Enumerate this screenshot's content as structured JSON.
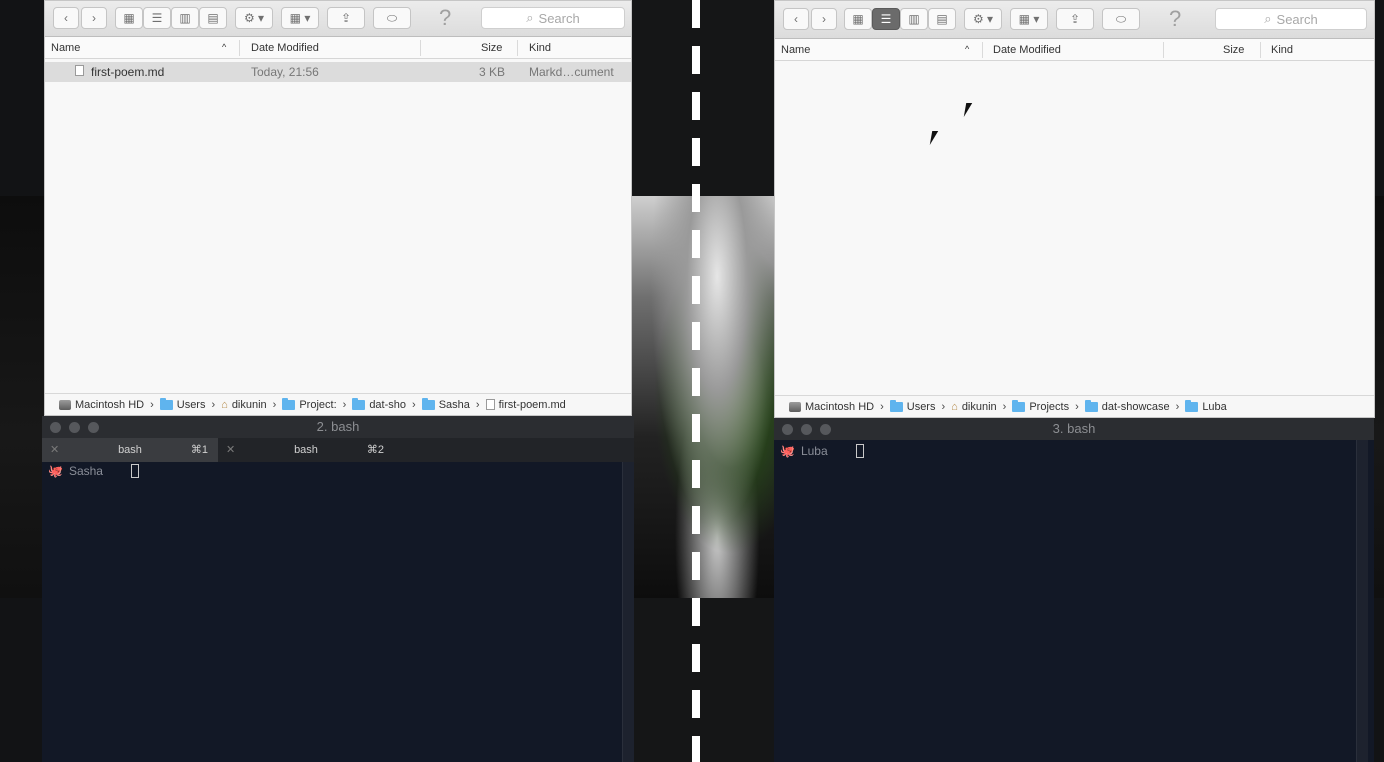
{
  "left_finder": {
    "nav_back_icon": "chevron-left-icon",
    "nav_forward_icon": "chevron-right-icon",
    "search_placeholder": "Search",
    "help_symbol": "?",
    "columns": {
      "name": "Name",
      "date": "Date Modified",
      "size": "Size",
      "kind": "Kind"
    },
    "files": [
      {
        "name": "first-poem.md",
        "date": "Today, 21:56",
        "size": "3 KB",
        "kind": "Markd…cument"
      }
    ],
    "path": [
      "Macintosh HD",
      "Users",
      "dikunin",
      "Project:",
      "dat-sho",
      "Sasha",
      "first-poem.md"
    ]
  },
  "right_finder": {
    "search_placeholder": "Search",
    "help_symbol": "?",
    "columns": {
      "name": "Name",
      "date": "Date Modified",
      "size": "Size",
      "kind": "Kind"
    },
    "path": [
      "Macintosh HD",
      "Users",
      "dikunin",
      "Projects",
      "dat-showcase",
      "Luba"
    ]
  },
  "left_terminal": {
    "title": "2. bash",
    "tabs": [
      {
        "label": "bash",
        "shortcut": "⌘1"
      },
      {
        "label": "bash",
        "shortcut": "⌘2"
      }
    ],
    "prompt_user": "Sasha"
  },
  "right_terminal": {
    "title": "3. bash",
    "prompt_user": "Luba"
  }
}
